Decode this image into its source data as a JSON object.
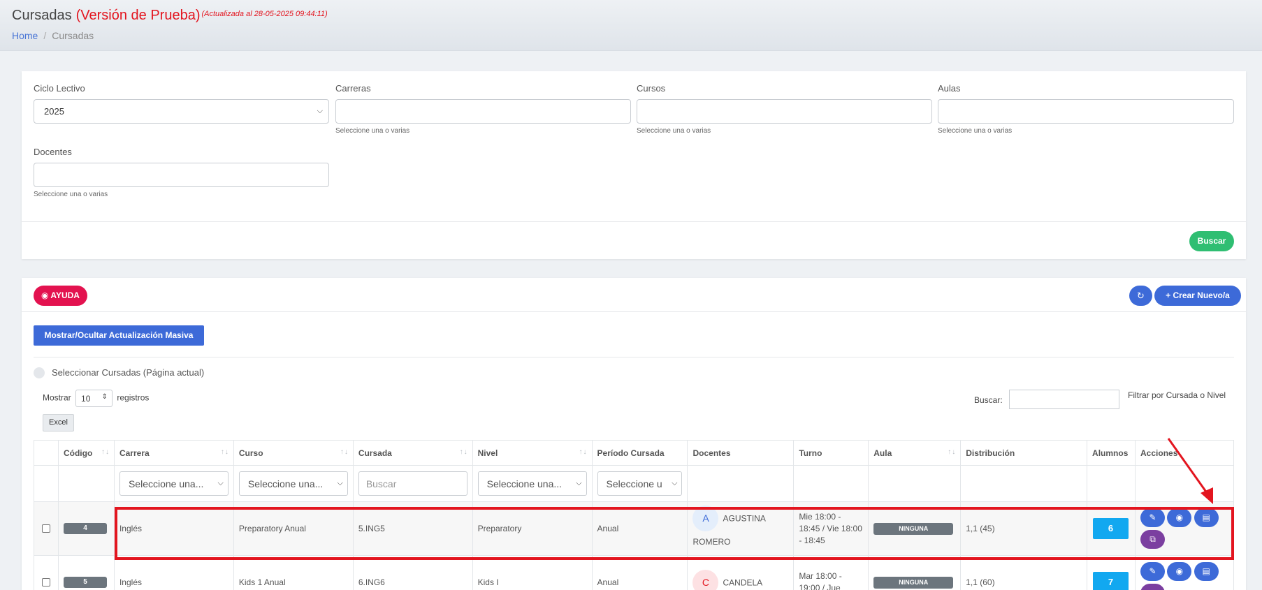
{
  "header": {
    "title": "Cursadas",
    "trial": "(Versión de Prueba)",
    "updated": "(Actualizada al 28-05-2025 09:44:11)",
    "breadcrumb": {
      "home": "Home",
      "sep": "/",
      "current": "Cursadas"
    }
  },
  "filters": {
    "ciclo": {
      "label": "Ciclo Lectivo",
      "value": "2025"
    },
    "carreras": {
      "label": "Carreras",
      "hint": "Seleccione una o varias"
    },
    "cursos": {
      "label": "Cursos",
      "hint": "Seleccione una o varias"
    },
    "aulas": {
      "label": "Aulas",
      "hint": "Seleccione una o varias"
    },
    "docentes": {
      "label": "Docentes",
      "hint": "Seleccione una o varias"
    },
    "search_button": "Buscar"
  },
  "toolbar": {
    "ayuda": "AYUDA",
    "refresh_icon": "↻",
    "crear": "Crear Nuevo/a",
    "masiva": "Mostrar/Ocultar Actualización Masiva",
    "select_page": "Seleccionar Cursadas (Página actual)",
    "mostrar": "Mostrar",
    "mostrar_value": "10",
    "registros": "registros",
    "excel": "Excel",
    "buscar_label": "Buscar:",
    "filtrar": "Filtrar por Cursada o Nivel"
  },
  "table": {
    "headers": [
      "Código",
      "Carrera",
      "Curso",
      "Cursada",
      "Nivel",
      "Período Cursada",
      "Docentes",
      "Turno",
      "Aula",
      "Distribución",
      "Alumnos",
      "Acciones"
    ],
    "filter_placeholder": "Seleccione una...",
    "filter_short": "Seleccione u",
    "search_placeholder": "Buscar",
    "rows": [
      {
        "codigo": "4",
        "carrera": "Inglés",
        "curso": "Preparatory Anual",
        "cursada": "5.ING5",
        "nivel": "Preparatory",
        "periodo": "Anual",
        "docente_initial": "A",
        "docente_line1": "AGUSTINA",
        "docente_line2": "ROMERO",
        "turno": "Mie 18:00 - 18:45 / Vie 18:00 - 18:45",
        "aula": "NINGUNA",
        "distribucion": "1,1 (45)",
        "alumnos": "6"
      },
      {
        "codigo": "5",
        "carrera": "Inglés",
        "curso": "Kids 1 Anual",
        "cursada": "6.ING6",
        "nivel": "Kids I",
        "periodo": "Anual",
        "docente_initial": "C",
        "docente_line1": "CANDELA",
        "docente_line2": "",
        "turno": "Mar 18:00 - 19:00 / Jue",
        "aula": "NINGUNA",
        "distribucion": "1,1 (60)",
        "alumnos": "7"
      }
    ]
  },
  "colors": {
    "accent": "#3d6ad8",
    "danger": "#e3151f",
    "success": "#2fbe72",
    "info": "#12a8f0",
    "purple": "#7b3fa0"
  }
}
